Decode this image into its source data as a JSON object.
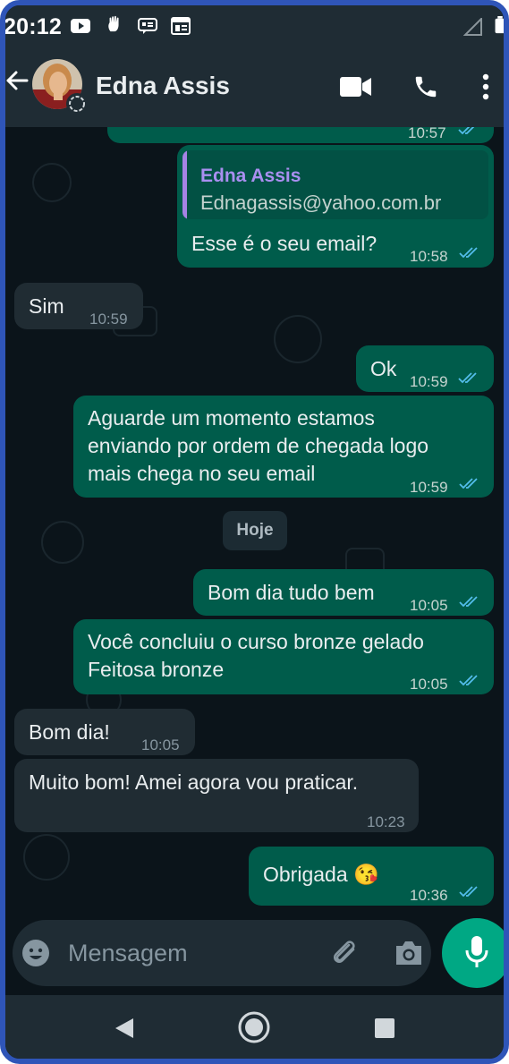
{
  "status_bar": {
    "time": "20:12"
  },
  "header": {
    "contact_name": "Edna Assis"
  },
  "messages": [
    {
      "direction": "out",
      "time": "10:57"
    },
    {
      "direction": "out",
      "quote_name": "Edna Assis",
      "quote_text": "Ednagassis@yahoo.com.br",
      "text": "Esse é o seu email?",
      "time": "10:58"
    },
    {
      "direction": "in",
      "text": "Sim",
      "time": "10:59"
    },
    {
      "direction": "out",
      "text": "Ok",
      "time": "10:59"
    },
    {
      "direction": "out",
      "lines": [
        "Aguarde um momento estamos",
        "enviando por ordem de chegada logo",
        "mais chega no seu email"
      ],
      "time": "10:59"
    },
    {
      "direction": "out",
      "text": "Bom dia tudo bem",
      "time": "10:05"
    },
    {
      "direction": "out",
      "lines": [
        "Você concluiu o curso bronze gelado",
        "Feitosa bronze"
      ],
      "time": "10:05"
    },
    {
      "direction": "in",
      "text": "Bom dia!",
      "time": "10:05"
    },
    {
      "direction": "in",
      "text": "Muito bom! Amei agora vou praticar.",
      "time": "10:23"
    },
    {
      "direction": "out",
      "text": "Obrigada 😘",
      "time": "10:36"
    }
  ],
  "day_separator": "Hoje",
  "composer": {
    "placeholder": "Mensagem"
  },
  "colors": {
    "outgoing_bubble": "#005c4b",
    "incoming_bubble": "#202c33",
    "chat_background": "#0b141a",
    "accent": "#00a884",
    "read_ticks": "#53bdeb",
    "frame_border": "#2f55b8"
  },
  "icons": [
    "back-arrow-icon",
    "video-call-icon",
    "phone-icon",
    "more-vert-icon",
    "emoji-icon",
    "attach-icon",
    "camera-icon",
    "mic-icon",
    "nav-back-icon",
    "nav-home-icon",
    "nav-recents-icon"
  ]
}
